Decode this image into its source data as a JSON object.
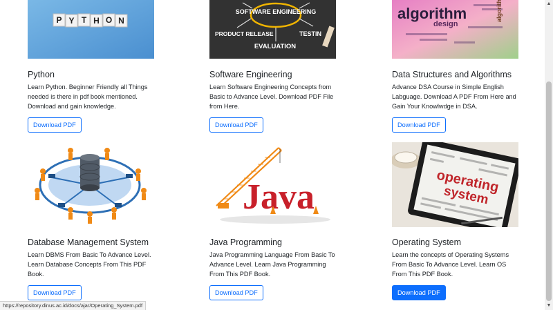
{
  "courses": [
    {
      "title": "Python",
      "description": "Learn Python. Beginner Friendly all Things needed is there in pdf book mentioned. Download and gain knowledge.",
      "button": "Download PDF",
      "image_text": "PYTHON"
    },
    {
      "title": "Software Engineering",
      "description": "Learn Software Engineering Concepts from Basic to Advance Level. Download PDF File from Here.",
      "button": "Download PDF",
      "image_text": {
        "center": "SOFTWARE ENGINEERING",
        "left": "PRODUCT RELEASE",
        "right": "TESTIN",
        "bottom": "EVALUATION"
      }
    },
    {
      "title": "Data Structures and Algorithms",
      "description": "Advance DSA Course in Simple English Labguage. Download A PDF From Here and Gain Your Knowlwdge in DSA.",
      "button": "Download PDF",
      "image_text": {
        "main": "algorithm",
        "sub": "design"
      }
    },
    {
      "title": "Database Management System",
      "description": "Learn DBMS From Basic To Advance Level. Learn Database Concepts From This PDF Book.",
      "button": "Download PDF"
    },
    {
      "title": "Java Programming",
      "description": "Java Programming Language From Basic To Advance Level. Learn Java Programming From This PDF Book.",
      "button": "Download PDF",
      "image_text": "Java"
    },
    {
      "title": "Operating System",
      "description": "Learn the concepts of Operating Systems From Basic To Advance Level. Learn OS From This PDF Book.",
      "button": "Download PDF",
      "image_text": {
        "line1": "operating",
        "line2": "system"
      }
    }
  ],
  "status_url": "https://repository.dinus.ac.id/docs/ajar/Operating_System.pdf",
  "colors": {
    "accent": "#0d6efd",
    "java_red": "#c8202a",
    "crane_orange": "#f08a16"
  }
}
